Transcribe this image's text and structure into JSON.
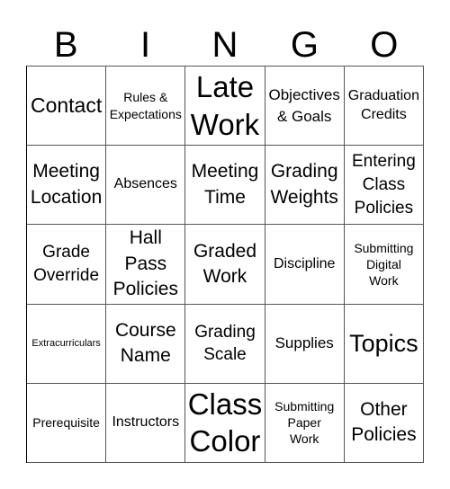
{
  "header": {
    "letters": [
      "B",
      "I",
      "N",
      "G",
      "O"
    ]
  },
  "card": {
    "rows": [
      [
        "Contact",
        "Rules &\nExpectations",
        "Late\nWork",
        "Objectives\n& Goals",
        "Graduation\nCredits"
      ],
      [
        "Meeting\nLocation",
        "Absences",
        "Meeting\nTime",
        "Grading\nWeights",
        "Entering\nClass\nPolicies"
      ],
      [
        "Grade\nOverride",
        "Hall\nPass\nPolicies",
        "Graded\nWork",
        "Discipline",
        "Submitting\nDigital\nWork"
      ],
      [
        "Extracurriculars",
        "Course\nName",
        "Grading\nScale",
        "Supplies",
        "Topics"
      ],
      [
        "Prerequisite",
        "Instructors",
        "Class\nColor",
        "Submitting\nPaper\nWork",
        "Other\nPolicies"
      ]
    ]
  }
}
